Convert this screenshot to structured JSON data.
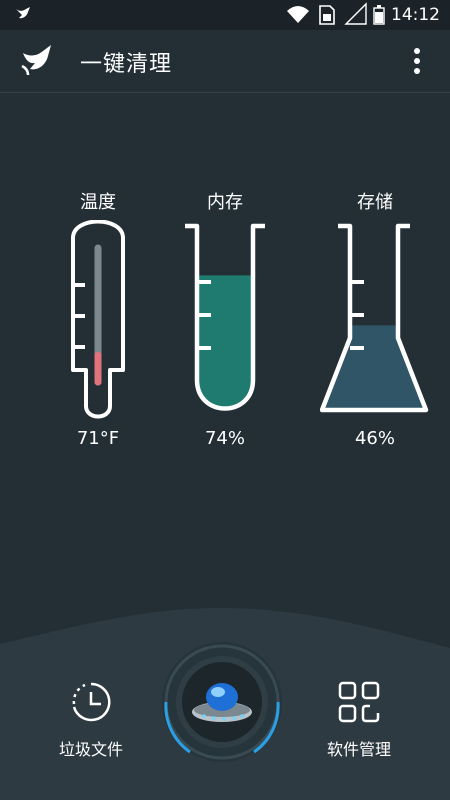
{
  "status_bar": {
    "app_icon": "broom-icon",
    "icons": [
      "wifi-icon",
      "sim-card-icon",
      "signal-empty-icon",
      "battery-icon"
    ],
    "time": "14:12"
  },
  "app_bar": {
    "logo_icon": "broom-icon",
    "title": "一键清理",
    "menu_icon": "more-vert-icon"
  },
  "gauges": {
    "temperature": {
      "label": "温度",
      "value": "71°F",
      "level": 0.2
    },
    "memory": {
      "label": "内存",
      "value": "74%",
      "level": 0.74
    },
    "storage": {
      "label": "存储",
      "value": "46%",
      "level": 0.46
    }
  },
  "tools": {
    "junk": {
      "label": "垃圾文件",
      "icon": "clock-history-icon"
    },
    "software": {
      "label": "软件管理",
      "icon": "apps-grid-icon"
    }
  },
  "clean_button": {
    "icon": "ufo-clean-icon"
  },
  "colors": {
    "background": "#232f35",
    "status_bar": "#1b2328",
    "panel": "#2e3a41",
    "memory_fill": "#1f7a70",
    "storage_fill": "#2f5566",
    "thermo_fill": "#e0737c",
    "accent": "#2aa1e6"
  }
}
